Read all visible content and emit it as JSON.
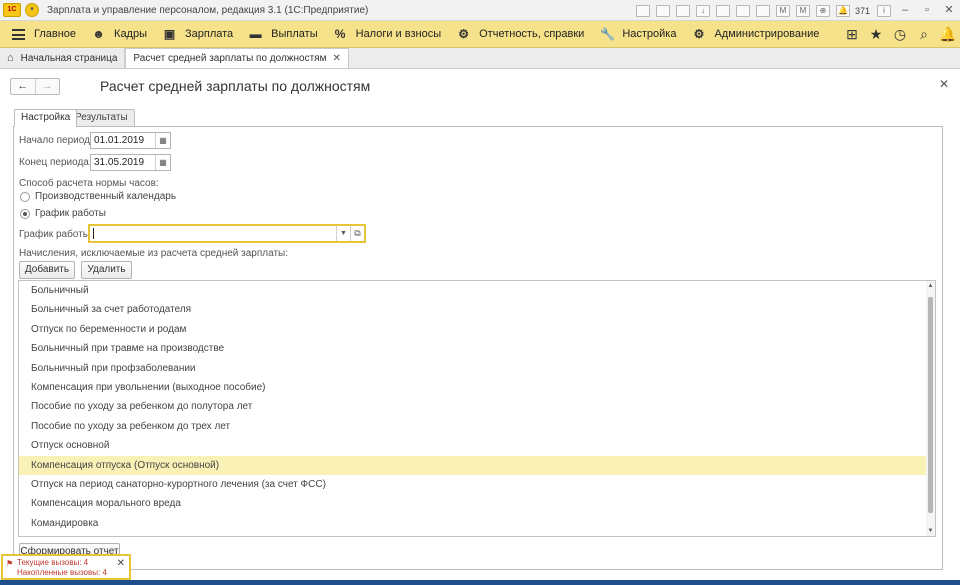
{
  "window": {
    "title": "Зарплата и управление персоналом, редакция 3.1  (1С:Предприятие)",
    "logo": "1С",
    "notification_count": "371"
  },
  "menu": {
    "items": [
      {
        "label": "Главное",
        "icon": "menu-lines-icon"
      },
      {
        "label": "Кадры",
        "icon": "people-icon"
      },
      {
        "label": "Зарплата",
        "icon": "payroll-icon"
      },
      {
        "label": "Выплаты",
        "icon": "money-icon"
      },
      {
        "label": "Налоги и взносы",
        "icon": "percent-icon"
      },
      {
        "label": "Отчетность, справки",
        "icon": "reports-icon"
      },
      {
        "label": "Настройка",
        "icon": "wrench-icon"
      },
      {
        "label": "Администрирование",
        "icon": "gear-icon"
      }
    ]
  },
  "tabs": {
    "home": "Начальная страница",
    "active": "Расчет средней зарплаты по должностям"
  },
  "form": {
    "title": "Расчет средней зарплаты по должностям",
    "tab_settings": "Настройка",
    "tab_results": "Результаты",
    "period_start_label": "Начало периода:",
    "period_start_value": "01.01.2019",
    "period_end_label": "Конец периода:",
    "period_end_value": "31.05.2019",
    "method_label": "Способ расчета нормы часов:",
    "radio_calendar": "Производственный календарь",
    "radio_schedule": "График работы",
    "schedule_label": "График работы:",
    "schedule_value": "",
    "exclusions_label": "Начисления, исключаемые из расчета средней зарплаты:",
    "add_button": "Добавить",
    "delete_button": "Удалить",
    "generate_button": "Сформировать отчет",
    "accruals": [
      "Больничный",
      "Больничный за счет работодателя",
      "Отпуск по беременности и родам",
      "Больничный при травме на производстве",
      "Больничный при профзаболевании",
      "Компенсация при увольнении (выходное пособие)",
      "Пособие по уходу за ребенком до полутора лет",
      "Пособие по уходу за ребенком до трех лет",
      "Отпуск основной",
      "Компенсация отпуска (Отпуск основной)",
      "Отпуск на период санаторно-курортного лечения (за счет ФСС)",
      "Компенсация морального вреда",
      "Командировка"
    ],
    "selected_index": 9
  },
  "popup": {
    "current_calls": "Текущие вызовы: 4",
    "accumulated_calls": "Накопленные вызовы: 4"
  },
  "colors": {
    "menu_bg": "#f6e28b",
    "selected_row": "#faf1b6",
    "focus_border": "#e8c439"
  }
}
